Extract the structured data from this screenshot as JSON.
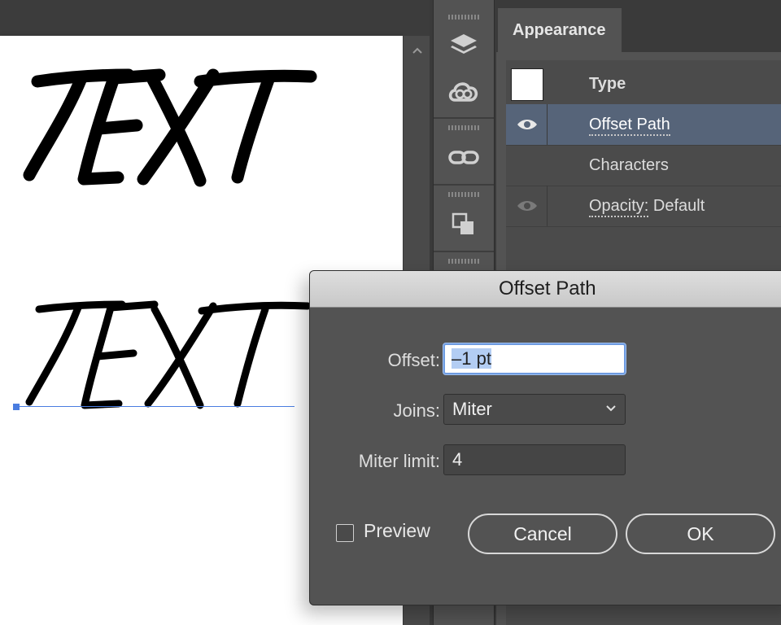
{
  "canvas": {
    "art_text_top": "TEXT",
    "art_text_bottom": "TEXT"
  },
  "toolbar": {
    "icons": [
      "layers-icon",
      "creative-cloud-libraries-icon",
      "links-icon",
      "pathfinder-icon"
    ]
  },
  "appearance_panel": {
    "tab_label": "Appearance",
    "rows": [
      {
        "label": "Type"
      },
      {
        "label": "Offset Path"
      },
      {
        "label": "Characters"
      },
      {
        "label": "Opacity:",
        "value": "Default"
      }
    ]
  },
  "dialog": {
    "title": "Offset Path",
    "offset_label": "Offset:",
    "offset_value": "–1 pt",
    "joins_label": "Joins:",
    "joins_value": "Miter",
    "miter_label": "Miter limit:",
    "miter_value": "4",
    "preview_label": "Preview",
    "cancel_label": "Cancel",
    "ok_label": "OK"
  },
  "colors": {
    "selection_row": "#566479",
    "focus_ring": "#6e9be0",
    "text_selection": "#b3cdf3",
    "anchor_blue": "#4a7de0"
  }
}
